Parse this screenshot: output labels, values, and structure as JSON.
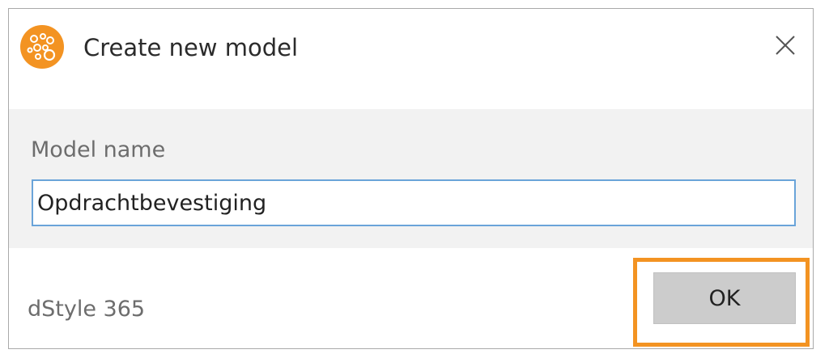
{
  "window": {
    "title": "Create new model",
    "icon": "dstyle-logo-icon",
    "close_icon": "close-icon"
  },
  "form": {
    "label": "Model name",
    "value": "Opdrachtbevestiging"
  },
  "footer": {
    "brand": "dStyle 365",
    "ok_label": "OK"
  },
  "colors": {
    "accent": "#f39322",
    "input_border": "#6aa4d9",
    "content_bg": "#f2f2f2",
    "button_bg": "#cccccc"
  }
}
